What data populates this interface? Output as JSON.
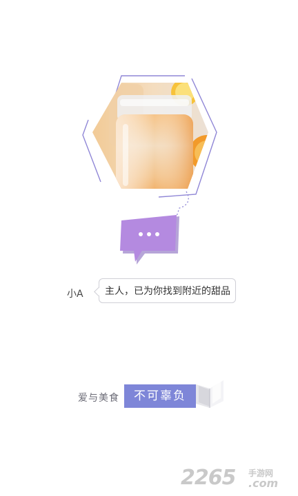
{
  "assistant": {
    "name": "小A",
    "message": "主人，已为你找到附近的甜品",
    "typing_indicator": "•••"
  },
  "slogan": {
    "left": "爱与美食",
    "box": "不可辜负"
  },
  "watermark": {
    "number": "2265",
    "site": "手游网",
    "domain": ".com"
  },
  "colors": {
    "accent_purple": "#b48ae0",
    "hex_outline": "#8f86d6",
    "slogan_box": "#7e86d8"
  },
  "icons": {
    "typing_bubble": "speech-bubble-icon",
    "book": "open-book-icon"
  }
}
